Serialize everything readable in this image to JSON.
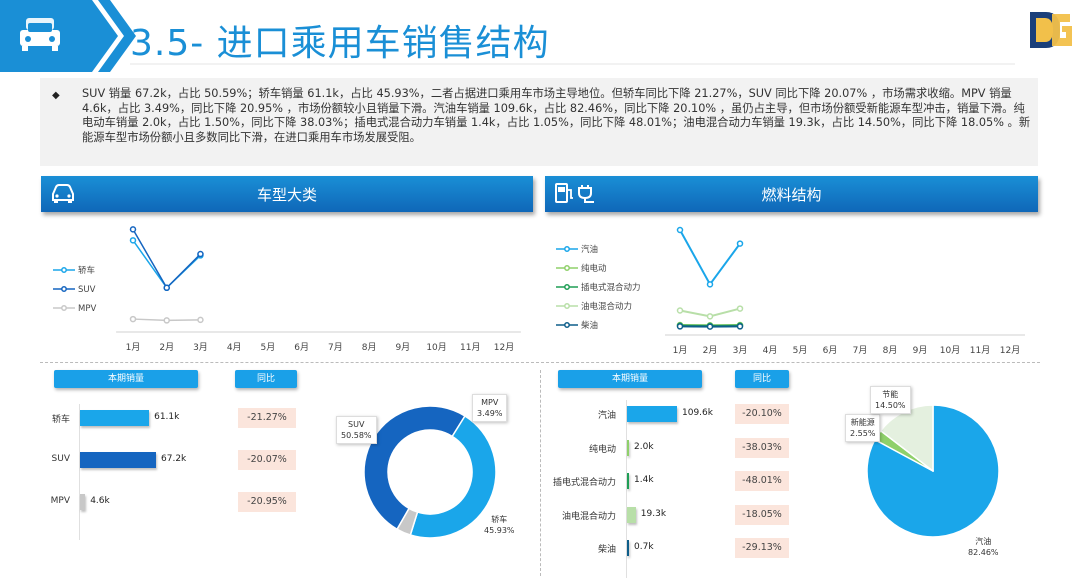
{
  "header": {
    "title": "3.5- 进口乘用车销售结构",
    "logo_text": "DG"
  },
  "summary": "SUV 销量 67.2k，占比 50.59%；轿车销量 61.1k，占比 45.93%，二者占据进口乘用车市场主导地位。但轿车同比下降 21.27%，SUV 同比下降 20.07% ，市场需求收缩。MPV 销量 4.6k，占比 3.49%，同比下降 20.95% ，市场份额较小且销量下滑。汽油车销量 109.6k，占比 82.46%，同比下降 20.10% ，虽仍占主导，但市场份额受新能源车型冲击，销量下滑。纯电动车销量 2.0k，占比 1.50%，同比下降 38.03%；插电式混合动力车销量 1.4k，占比 1.05%，同比下降 48.01%；油电混合动力车销量 19.3k，占比 14.50%，同比下降 18.05% 。新能源车型市场份额小且多数同比下滑，在进口乘用车市场发展受阻。",
  "colors": {
    "accent": "#1a8fd6",
    "sedan": "#1aa6ea",
    "suv": "#1565c0",
    "mpv": "#c8c8c8",
    "yoy_bg": "#fbe5dc"
  },
  "left": {
    "section_title": "车型大类",
    "icon": "car-icon",
    "months": [
      "1月",
      "2月",
      "3月",
      "4月",
      "5月",
      "6月",
      "7月",
      "8月",
      "9月",
      "10月",
      "11月",
      "12月"
    ],
    "current_header": "本期销量",
    "yoy_header": "同比",
    "chart_data": [
      {
        "type": "line",
        "x": [
          "1月",
          "2月",
          "3月",
          "4月",
          "5月",
          "6月",
          "7月",
          "8月",
          "9月",
          "10月",
          "11月",
          "12月"
        ],
        "series": [
          {
            "name": "轿车",
            "values": [
              30.5,
              13.2,
              25.0
            ],
            "color": "#1aa6ea"
          },
          {
            "name": "SUV",
            "values": [
              34.5,
              13.2,
              25.5
            ],
            "color": "#1565c0"
          },
          {
            "name": "MPV",
            "values": [
              1.8,
              1.3,
              1.5
            ],
            "color": "#c8c8c8"
          }
        ],
        "legend": "left"
      },
      {
        "type": "bar",
        "categories": [
          "轿车",
          "SUV",
          "MPV"
        ],
        "values": [
          61.1,
          67.2,
          4.6
        ],
        "value_labels": [
          "61.1k",
          "67.2k",
          "4.6k"
        ],
        "yoy": [
          "-21.27%",
          "-20.07%",
          "-20.95%"
        ]
      },
      {
        "type": "pie",
        "slices": [
          {
            "name": "SUV",
            "value": 50.58,
            "label": "50.58%",
            "color": "#1565c0"
          },
          {
            "name": "轿车",
            "value": 45.93,
            "label": "45.93%",
            "color": "#1aa6ea"
          },
          {
            "name": "MPV",
            "value": 3.49,
            "label": "3.49%",
            "color": "#c8c8c8"
          }
        ]
      }
    ]
  },
  "right": {
    "section_title": "燃料结构",
    "icon": "fuel-icon",
    "months": [
      "1月",
      "2月",
      "3月",
      "4月",
      "5月",
      "6月",
      "7月",
      "8月",
      "9月",
      "10月",
      "11月",
      "12月"
    ],
    "current_header": "本期销量",
    "yoy_header": "同比",
    "chart_data": [
      {
        "type": "line",
        "x": [
          "1月",
          "2月",
          "3月",
          "4月",
          "5月",
          "6月",
          "7月",
          "8月",
          "9月",
          "10月",
          "11月",
          "12月"
        ],
        "series": [
          {
            "name": "汽油",
            "values": [
              50.0,
              22.0,
              43.0
            ],
            "color": "#1aa6ea"
          },
          {
            "name": "纯电动",
            "values": [
              1.0,
              0.9,
              1.0
            ],
            "color": "#8fd06a"
          },
          {
            "name": "插电式混合动力",
            "values": [
              0.7,
              0.6,
              0.7
            ],
            "color": "#1f9e55"
          },
          {
            "name": "油电混合动力",
            "values": [
              8.5,
              5.5,
              9.5
            ],
            "color": "#b8dfa8"
          },
          {
            "name": "柴油",
            "values": [
              0.3,
              0.2,
              0.3
            ],
            "color": "#0e5e8a"
          }
        ],
        "legend": "left"
      },
      {
        "type": "bar",
        "categories": [
          "汽油",
          "纯电动",
          "插电式混合动力",
          "油电混合动力",
          "柴油"
        ],
        "values": [
          109.6,
          2.0,
          1.4,
          19.3,
          0.7
        ],
        "value_labels": [
          "109.6k",
          "2.0k",
          "1.4k",
          "19.3k",
          "0.7k"
        ],
        "yoy": [
          "-20.10%",
          "-38.03%",
          "-48.01%",
          "-18.05%",
          "-29.13%"
        ]
      },
      {
        "type": "pie",
        "slices": [
          {
            "name": "汽油",
            "value": 82.46,
            "label": "82.46%",
            "color": "#1aa6ea"
          },
          {
            "name": "新能源",
            "value": 2.55,
            "label": "2.55%",
            "color": "#8fd06a"
          },
          {
            "name": "节能",
            "value": 14.5,
            "label": "14.50%",
            "color": "#e4f0df"
          }
        ]
      }
    ]
  }
}
